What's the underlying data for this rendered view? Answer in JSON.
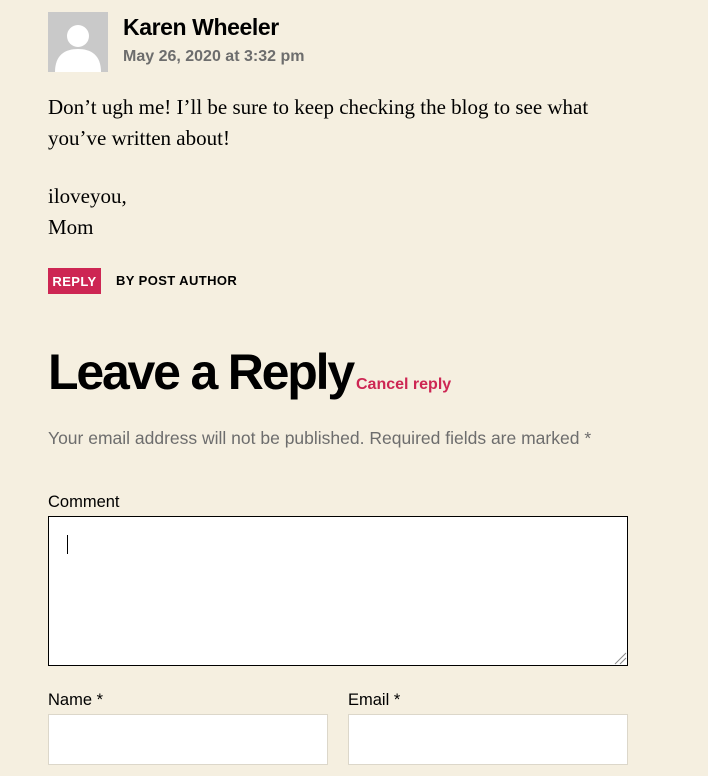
{
  "comment": {
    "author": "Karen Wheeler",
    "date": "May 26, 2020 at 3:32 pm",
    "paragraphs": [
      "Don’t ugh me! I’ll be sure to keep checking the blog to see what you’ve written about!",
      "iloveyou,"
    ],
    "signoff": "Mom",
    "reply_label": "REPLY",
    "by_author_label": "BY POST AUTHOR"
  },
  "reply_form": {
    "title": "Leave a Reply",
    "cancel_label": "Cancel reply",
    "notes": "Your email address will not be published. Required fields are marked *",
    "comment_label": "Comment",
    "comment_value": "",
    "name_label": "Name *",
    "name_value": "",
    "email_label": "Email *",
    "email_value": ""
  },
  "colors": {
    "background": "#f5efe0",
    "accent": "#cd2653",
    "muted_text": "#6d6d6d"
  }
}
